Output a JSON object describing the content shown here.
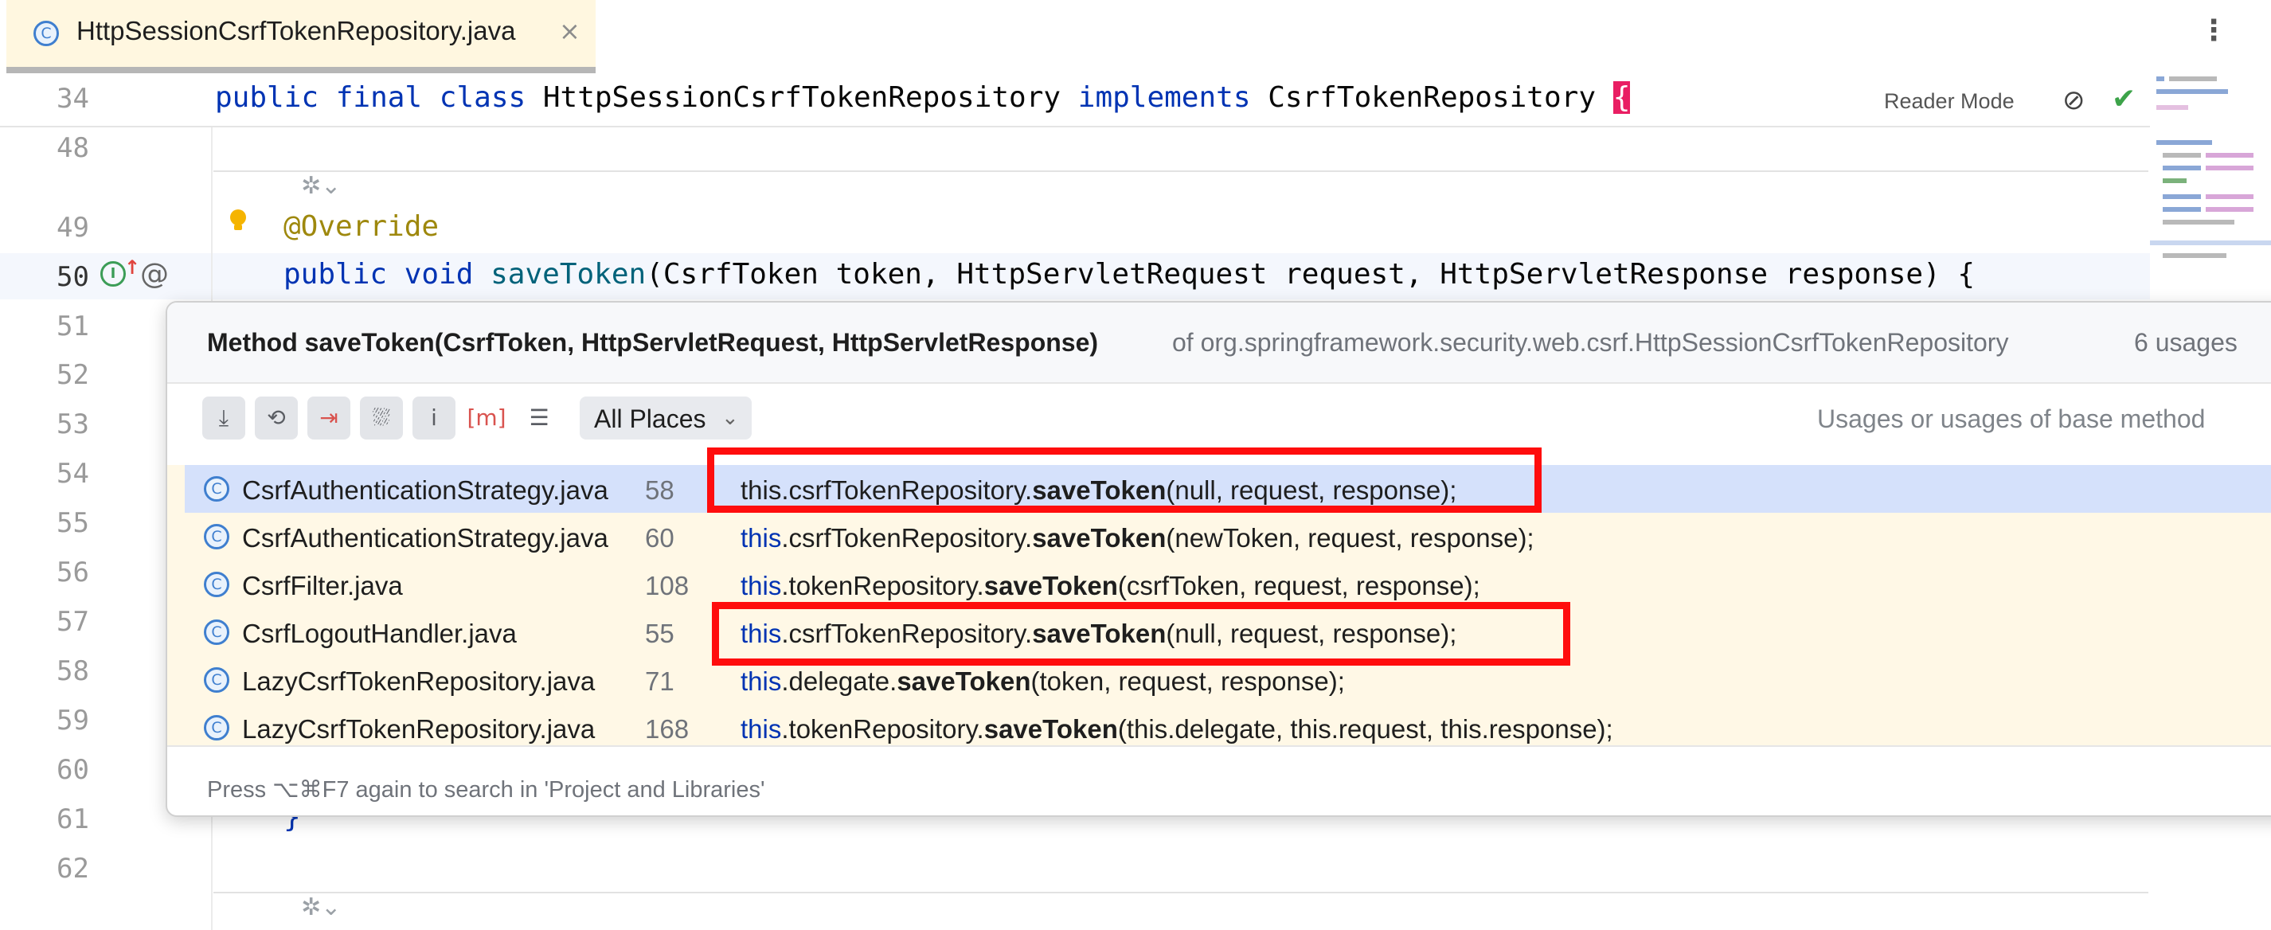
{
  "tab": {
    "title": "HttpSessionCsrfTokenRepository.java",
    "close": "×",
    "icon": "class-icon"
  },
  "more_menu": "⋮",
  "editor": {
    "line_numbers": [
      "34",
      "48",
      "49",
      "50",
      "51",
      "52",
      "53",
      "54",
      "55",
      "56",
      "57",
      "58",
      "59",
      "60",
      "61",
      "62"
    ],
    "sticky_line": {
      "kw1": "public",
      "kw2": "final",
      "kw3": "class",
      "name": "HttpSessionCsrfTokenRepository",
      "kw4": "implements",
      "iface": "CsrfTokenRepository",
      "brace": "{"
    },
    "annotation": "@Override",
    "signature": {
      "kw1": "public",
      "kw2": "void",
      "method": "saveToken",
      "params": "(CsrfToken token, HttpServletRequest request, HttpServletResponse response) {"
    },
    "closing_brace": "}",
    "reader_mode": "Reader Mode",
    "check": "✔",
    "eye": "⊘"
  },
  "popup": {
    "title": "Method saveToken(CsrfToken, HttpServletRequest, HttpServletResponse)",
    "of": "of org.springframework.security.web.csrf.HttpSessionCsrfTokenRepository",
    "usages": "6 usages",
    "toolbar": [
      "⤓",
      "⟲",
      "⇥",
      "⛆",
      "i",
      "[m]",
      "☰"
    ],
    "places": "All Places",
    "places_chevron": "⌄",
    "hint": "Usages or usages of base method",
    "rows": [
      {
        "file": "CsrfAuthenticationStrategy.java",
        "line": "58",
        "pre": "this",
        "mid": ".csrfTokenRepository.",
        "call": "saveToken",
        "args": "(null, request, response);"
      },
      {
        "file": "CsrfAuthenticationStrategy.java",
        "line": "60",
        "pre": "this",
        "mid": ".csrfTokenRepository.",
        "call": "saveToken",
        "args": "(newToken, request, response);"
      },
      {
        "file": "CsrfFilter.java",
        "line": "108",
        "pre": "this",
        "mid": ".tokenRepository.",
        "call": "saveToken",
        "args": "(csrfToken, request, response);"
      },
      {
        "file": "CsrfLogoutHandler.java",
        "line": "55",
        "pre": "this",
        "mid": ".csrfTokenRepository.",
        "call": "saveToken",
        "args": "(null, request, response);"
      },
      {
        "file": "LazyCsrfTokenRepository.java",
        "line": "71",
        "pre": "this",
        "mid": ".delegate.",
        "call": "saveToken",
        "args": "(token, request, response);"
      },
      {
        "file": "LazyCsrfTokenRepository.java",
        "line": "168",
        "pre": "this",
        "mid": ".tokenRepository.",
        "call": "saveToken",
        "args": "(this.delegate, this.request, this.response);"
      }
    ],
    "footer": "Press ⌥⌘F7 again to search in 'Project and Libraries'"
  },
  "colors": {
    "highlight_box": "#ff0d0d",
    "selected_row": "#d5e1fb",
    "results_bg": "#fff8e6",
    "keyword": "#0033b3"
  }
}
